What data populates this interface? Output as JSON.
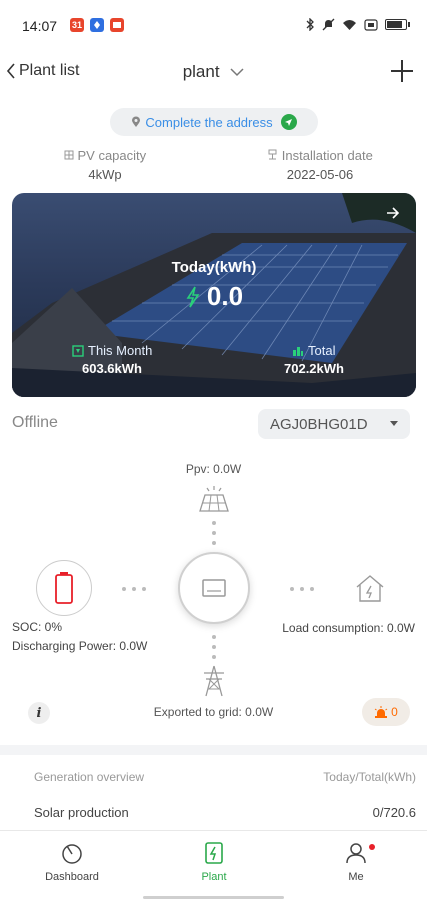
{
  "status_bar": {
    "time": "14:07",
    "notifications": [
      {
        "icon": "calendar-notif-icon",
        "text": "31",
        "color": "#e8452c"
      },
      {
        "icon": "app-notif-icon",
        "text": "",
        "color": "#2f6fe0"
      },
      {
        "icon": "mail-notif-icon",
        "text": "",
        "color": "#e8452c"
      }
    ],
    "right_icons": [
      "bluetooth-icon",
      "mute-icon",
      "wifi-icon",
      "dual-sim-icon",
      "battery-icon"
    ],
    "battery_level": 0.9
  },
  "header": {
    "back_label": "Plant list",
    "title": "plant"
  },
  "address": {
    "text": "Complete the address"
  },
  "info": {
    "pv_capacity_label": "PV capacity",
    "pv_capacity_value": "4kWp",
    "install_date_label": "Installation date",
    "install_date_value": "2022-05-06"
  },
  "card": {
    "today_label": "Today(kWh)",
    "today_value": "0.0",
    "month_label": "This Month",
    "month_value": "603.6kWh",
    "total_label": "Total",
    "total_value": "702.2kWh"
  },
  "device": {
    "status": "Offline",
    "serial": "AGJ0BHG01D"
  },
  "flow": {
    "ppv": "Ppv: 0.0W",
    "soc": "SOC: 0%",
    "discharging": "Discharging Power: 0.0W",
    "load": "Load consumption: 0.0W",
    "exported": "Exported to grid: 0.0W",
    "alarm_count": "0"
  },
  "generation": {
    "overview_label": "Generation overview",
    "overview_unit": "Today/Total(kWh)",
    "solar_label": "Solar production",
    "solar_value": "0/720.6"
  },
  "nav": {
    "dashboard": "Dashboard",
    "plant": "Plant",
    "me": "Me"
  },
  "colors": {
    "accent_green": "#2aa84a",
    "link_blue": "#3a8ee6",
    "alarm_orange": "#ff6a00"
  }
}
